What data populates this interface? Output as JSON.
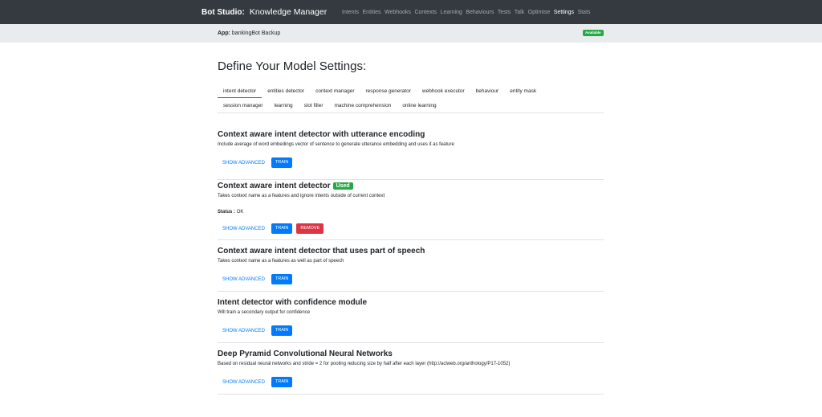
{
  "navbar": {
    "brand": "Bot Studio:",
    "subtitle": "Knowledge Manager",
    "links": [
      {
        "label": "Intents",
        "active": false
      },
      {
        "label": "Entities",
        "active": false
      },
      {
        "label": "Webhooks",
        "active": false
      },
      {
        "label": "Contexts",
        "active": false
      },
      {
        "label": "Learning",
        "active": false
      },
      {
        "label": "Behaviours",
        "active": false
      },
      {
        "label": "Tests",
        "active": false
      },
      {
        "label": "Talk",
        "active": false
      },
      {
        "label": "Optimise",
        "active": false
      },
      {
        "label": "Settings",
        "active": true
      },
      {
        "label": "Stats",
        "active": false
      }
    ]
  },
  "appbar": {
    "label": "App:",
    "name": "bankingBot Backup",
    "status_badge": "Available"
  },
  "main": {
    "title": "Define Your Model Settings:",
    "tabs_row1": [
      "intent detector",
      "entities detector",
      "context manager",
      "response generator",
      "webhook executor",
      "behaviour",
      "entity mask"
    ],
    "tabs_row2": [
      "session manager",
      "learning",
      "slot filler",
      "machine comprehension",
      "online learning"
    ],
    "active_tab": "intent detector",
    "sections": [
      {
        "title": "Context aware intent detector with utterance encoding",
        "description": "Include average of word embedings vector of sentence to generate utterance embedding and uses it as feature",
        "show_advanced": "SHOW ADVANCED",
        "train": "TRAIN"
      },
      {
        "title": "Context aware intent detector",
        "used_badge": "Used",
        "description": "Takes context name as a features and ignore intents outside of current context",
        "status_label": "Status :",
        "status_value": "OK",
        "show_advanced": "SHOW ADVANCED",
        "train": "TRAIN",
        "remove": "REMOVE"
      },
      {
        "title": "Context aware intent detector that uses part of speech",
        "description": "Takes context name as a features as well as part of speech",
        "show_advanced": "SHOW ADVANCED",
        "train": "TRAIN"
      },
      {
        "title": "Intent detector with confidence module",
        "description": "Will train a secondary output for confidence",
        "show_advanced": "SHOW ADVANCED",
        "train": "TRAIN"
      },
      {
        "title": "Deep Pyramid Convolutional Neural Networks",
        "description": "Based on residual neural networks and stride = 2 for pooling reducing size by half after each layer (http://aclweb.org/anthology/P17-1052)",
        "show_advanced": "SHOW ADVANCED",
        "train": "TRAIN"
      }
    ]
  },
  "colors": {
    "navbar_bg": "#343a40",
    "appbar_bg": "#e9ecef",
    "primary": "#007bff",
    "success": "#28a745",
    "danger": "#dc3545"
  }
}
